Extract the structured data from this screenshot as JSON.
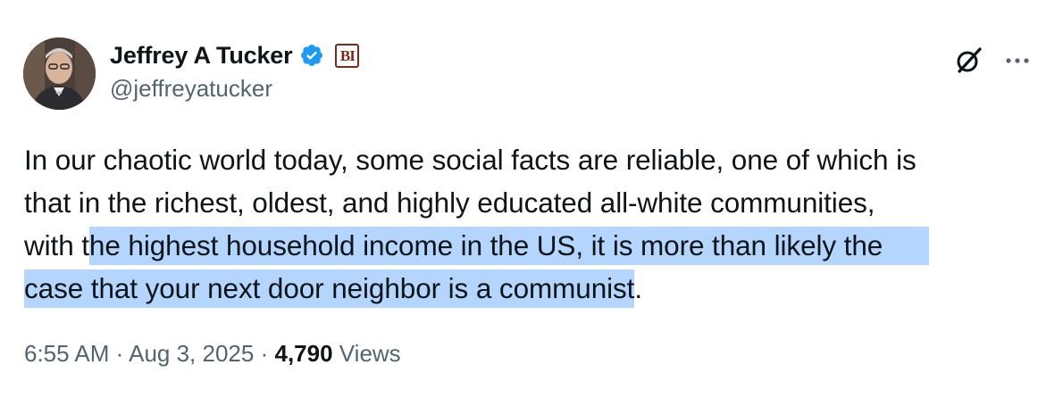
{
  "author": {
    "display_name": "Jeffrey A Tucker",
    "handle": "@jeffreyatucker",
    "avatar_icon": "profile-photo",
    "verified_icon": "verified-badge-icon",
    "verified_color": "#1d9bf0",
    "affiliate_badge_text": "BI",
    "affiliate_color": "#7a2a1a"
  },
  "header_icons": {
    "grok": "grok-icon",
    "more": "more-horizontal-icon"
  },
  "tweet": {
    "lines": [
      {
        "plain": "In our chaotic world today, some social facts are reliable, one of which is",
        "sel": "",
        "after": ""
      },
      {
        "plain": "that in the richest, oldest, and highly educated all-white communities,",
        "sel": "",
        "after": ""
      },
      {
        "plain": "with t",
        "sel": "he highest household income in the US, it is more than likely the",
        "after": ""
      },
      {
        "plain": "",
        "sel": "case that your next door neighbor is a communist",
        "after": "."
      }
    ],
    "selection_color": "#b4d5fe"
  },
  "meta": {
    "time": "6:55 AM",
    "separator": "·",
    "date": "Aug 3, 2025",
    "views_count": "4,790",
    "views_label": "Views"
  }
}
